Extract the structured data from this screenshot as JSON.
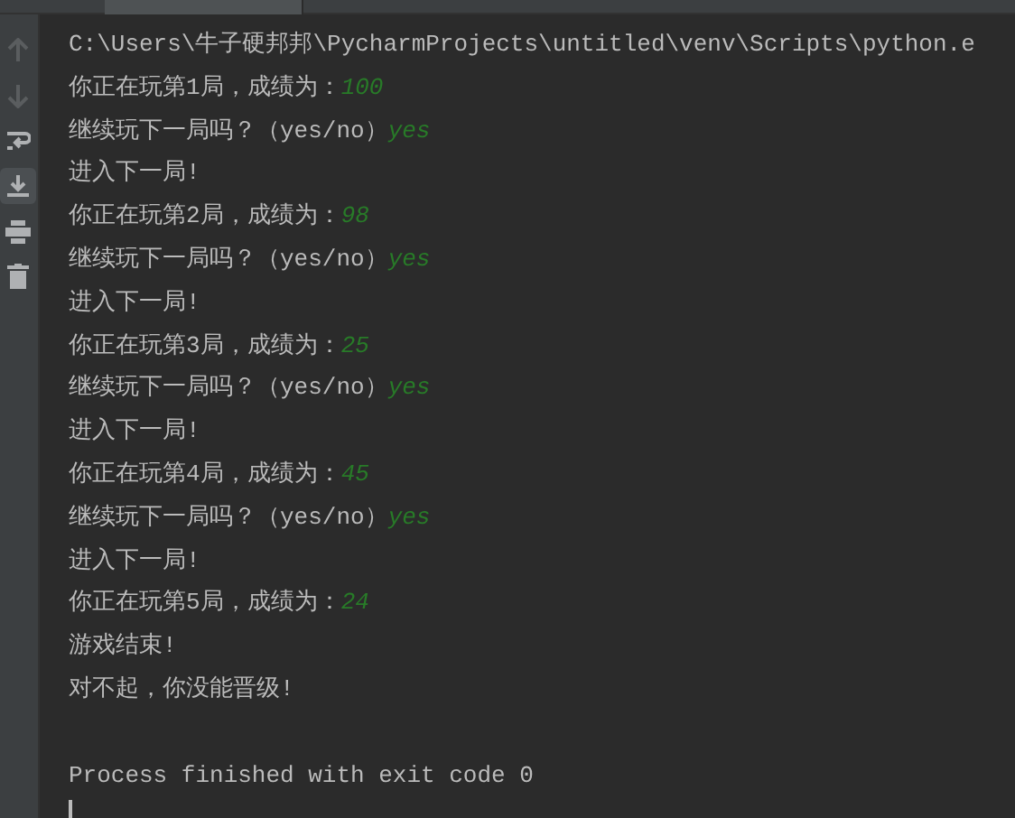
{
  "console": {
    "lines": [
      [
        {
          "kind": "output",
          "text": "C:\\Users\\牛子硬邦邦\\PycharmProjects\\untitled\\venv\\Scripts\\python.e"
        }
      ],
      [
        {
          "kind": "output",
          "text": "你正在玩第1局，成绩为："
        },
        {
          "kind": "input",
          "text": "100"
        }
      ],
      [
        {
          "kind": "output",
          "text": "继续玩下一局吗？（yes/no）"
        },
        {
          "kind": "input",
          "text": "yes"
        }
      ],
      [
        {
          "kind": "output",
          "text": "进入下一局!"
        }
      ],
      [
        {
          "kind": "output",
          "text": "你正在玩第2局，成绩为："
        },
        {
          "kind": "input",
          "text": "98"
        }
      ],
      [
        {
          "kind": "output",
          "text": "继续玩下一局吗？（yes/no）"
        },
        {
          "kind": "input",
          "text": "yes"
        }
      ],
      [
        {
          "kind": "output",
          "text": "进入下一局!"
        }
      ],
      [
        {
          "kind": "output",
          "text": "你正在玩第3局，成绩为："
        },
        {
          "kind": "input",
          "text": "25"
        }
      ],
      [
        {
          "kind": "output",
          "text": "继续玩下一局吗？（yes/no）"
        },
        {
          "kind": "input",
          "text": "yes"
        }
      ],
      [
        {
          "kind": "output",
          "text": "进入下一局!"
        }
      ],
      [
        {
          "kind": "output",
          "text": "你正在玩第4局，成绩为："
        },
        {
          "kind": "input",
          "text": "45"
        }
      ],
      [
        {
          "kind": "output",
          "text": "继续玩下一局吗？（yes/no）"
        },
        {
          "kind": "input",
          "text": "yes"
        }
      ],
      [
        {
          "kind": "output",
          "text": "进入下一局!"
        }
      ],
      [
        {
          "kind": "output",
          "text": "你正在玩第5局，成绩为："
        },
        {
          "kind": "input",
          "text": "24"
        }
      ],
      [
        {
          "kind": "output",
          "text": "游戏结束!"
        }
      ],
      [
        {
          "kind": "output",
          "text": "对不起，你没能晋级!"
        }
      ]
    ],
    "exit_message": "Process finished with exit code 0"
  }
}
